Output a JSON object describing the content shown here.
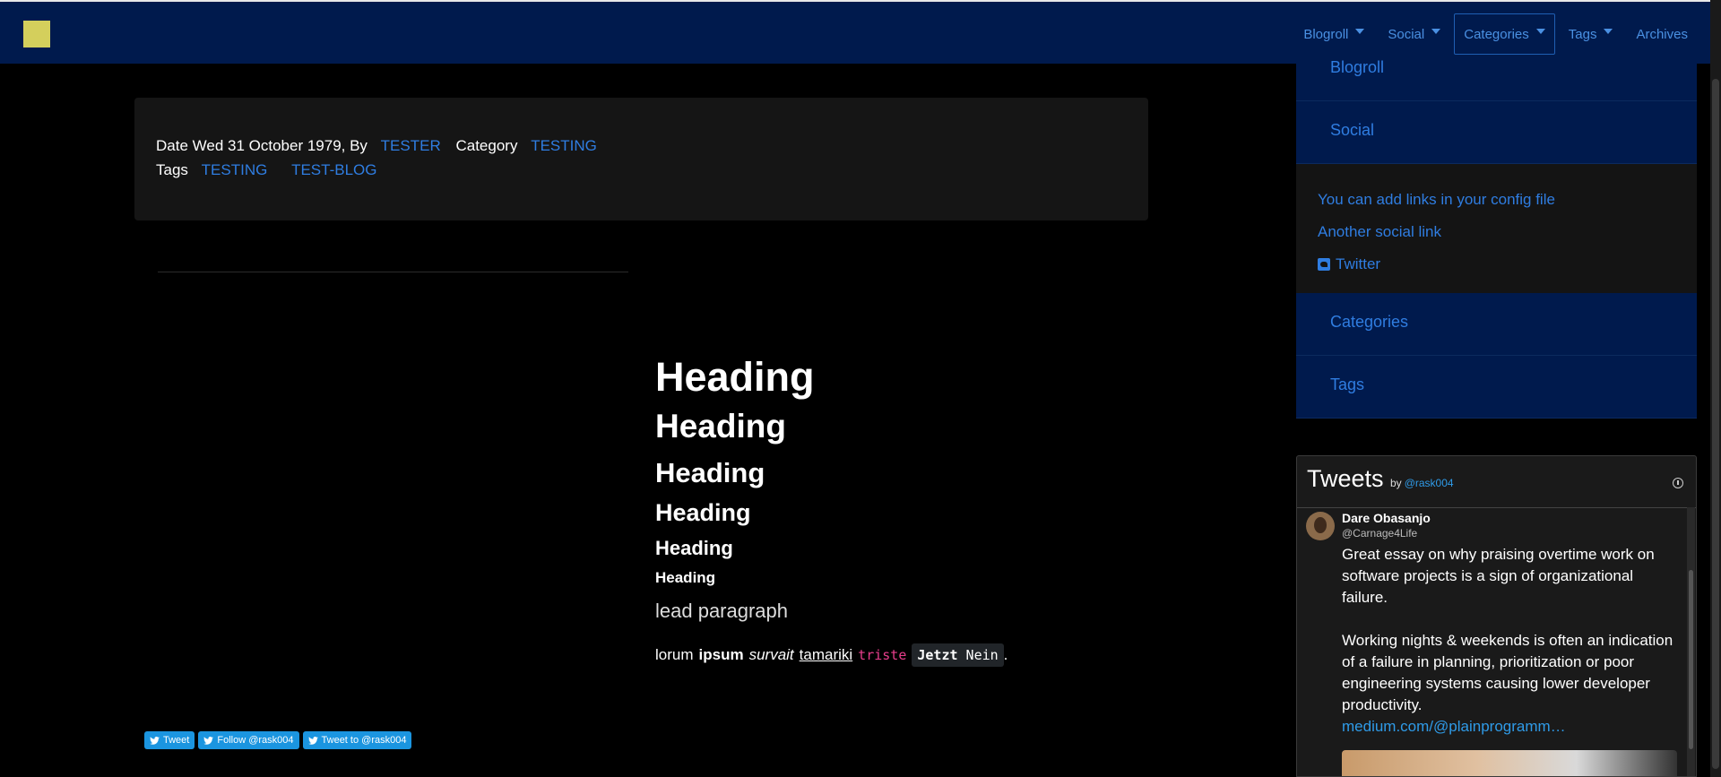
{
  "navbar": {
    "items": [
      {
        "label": "Blogroll",
        "dropdown": true
      },
      {
        "label": "Social",
        "dropdown": true
      },
      {
        "label": "Categories",
        "dropdown": true,
        "active": true
      },
      {
        "label": "Tags",
        "dropdown": true
      },
      {
        "label": "Archives",
        "dropdown": false
      }
    ]
  },
  "meta": {
    "date_prefix": "Date Wed 31 October 1979, By",
    "author": "TESTER",
    "category_label": "Category",
    "category": "TESTING",
    "tags_label": "Tags",
    "tags": [
      "TESTING",
      "TEST-BLOG"
    ]
  },
  "content": {
    "headings": [
      "Heading",
      "Heading",
      "Heading",
      "Heading",
      "Heading",
      "Heading"
    ],
    "lead": "lead paragraph",
    "para": {
      "w1": "lorum",
      "w2": "ipsum",
      "w3": "survait",
      "w4": "tamariki",
      "code": "triste",
      "kbd1": "Jetzt",
      "kbd2": "Nein",
      "end": "."
    }
  },
  "share": {
    "tweet": "Tweet",
    "follow": "Follow @rask004",
    "tweet_to": "Tweet to @rask004"
  },
  "sidebar": {
    "blogroll": "Blogroll",
    "social": "Social",
    "links": [
      "You can add links in your config file",
      "Another social link",
      "Twitter"
    ],
    "categories": "Categories",
    "tags": "Tags"
  },
  "tweets": {
    "title": "Tweets",
    "by": "by",
    "handle": "@rask004",
    "tweet": {
      "name": "Dare Obasanjo",
      "handle": "@Carnage4Life",
      "p1": "Great essay on why praising overtime work on software projects is a sign of organizational failure.",
      "p2": "Working nights & weekends is often an indication of a failure in planning, prioritization or poor engineering systems causing lower developer productivity.",
      "link": "medium.com/@plainprogramm…"
    }
  },
  "colors": {
    "navbar_bg": "#001a4d",
    "link": "#2f7de1",
    "twitter_blue": "#1b95e0"
  }
}
